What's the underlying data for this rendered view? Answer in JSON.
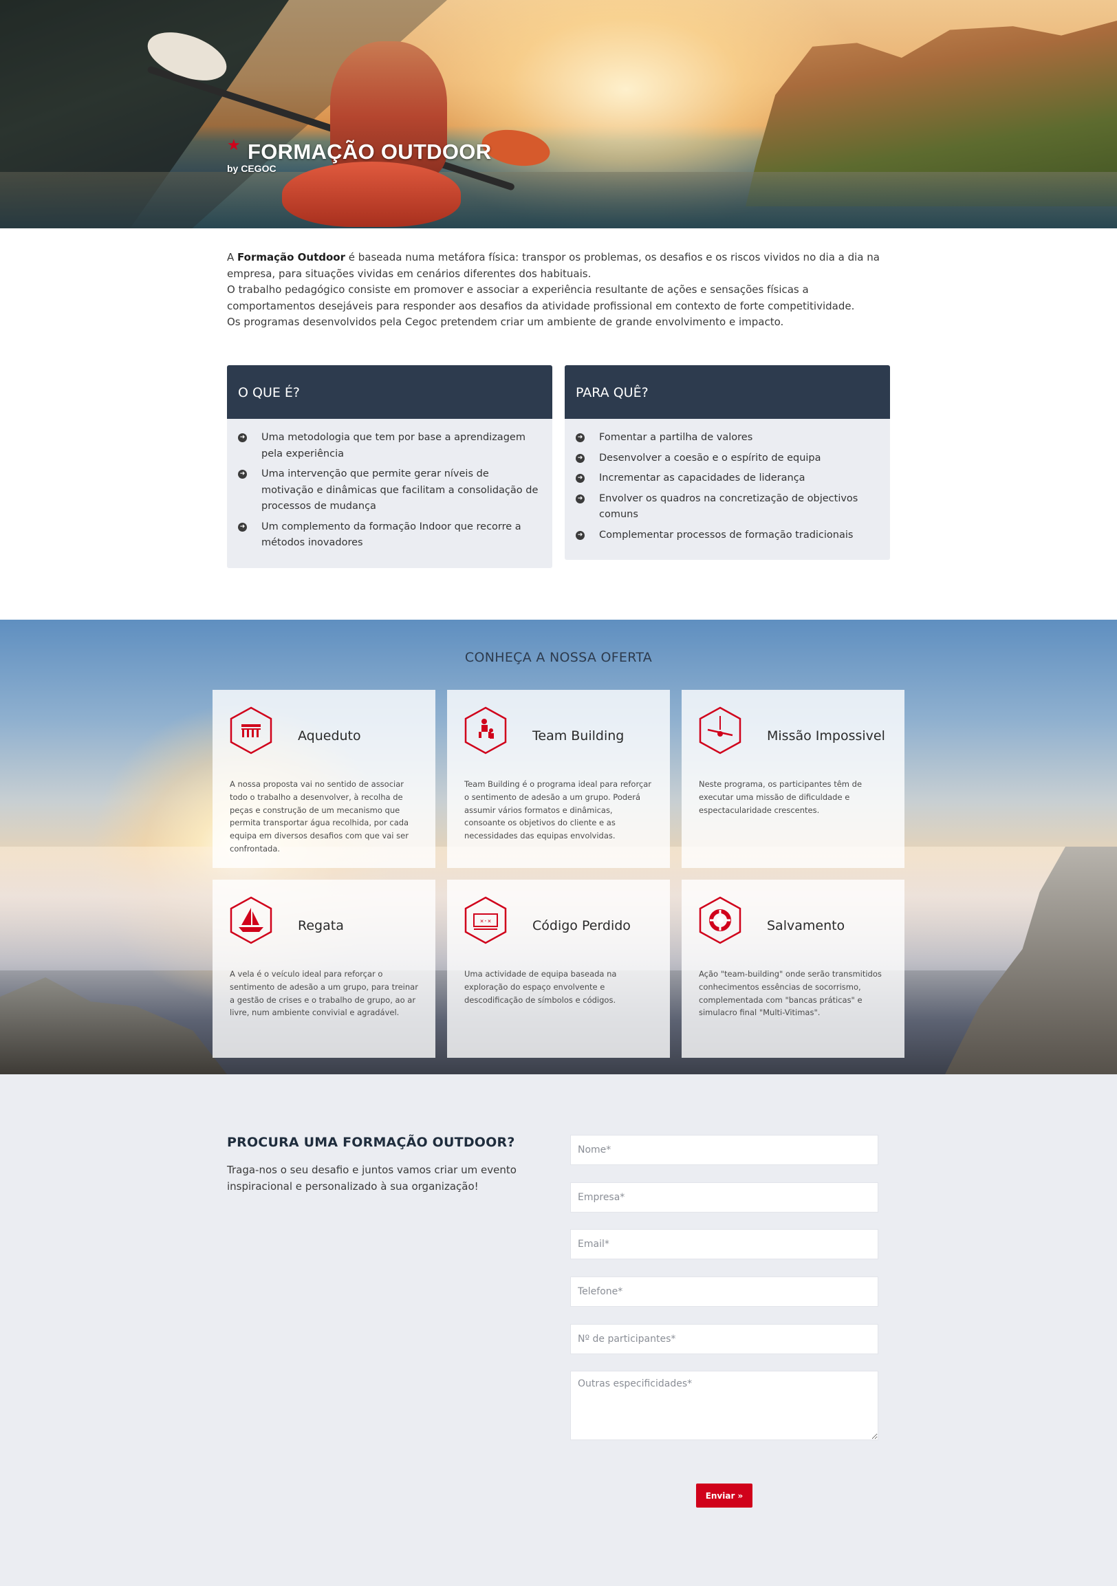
{
  "hero": {
    "title": "FORMAÇÃO OUTDOOR",
    "byline": "by CEGOC"
  },
  "intro": {
    "p1_prefix": "A ",
    "p1_bold": "Formação Outdoor",
    "p1_rest": " é baseada numa metáfora física: transpor os problemas, os desafios e os riscos vividos no dia a dia na empresa, para situações vividas em cenários diferentes dos habituais.",
    "p2": "O trabalho pedagógico consiste em promover e associar a experiência resultante de ações e sensações físicas a comportamentos desejáveis para responder aos desafios da atividade profissional em contexto de forte competitividade.",
    "p3": "Os programas desenvolvidos pela Cegoc pretendem criar um ambiente de grande envolvimento e impacto."
  },
  "what": {
    "title": "O QUE É?",
    "items": [
      "Uma metodologia que tem por base a aprendizagem pela experiência",
      "Uma intervenção que permite gerar níveis de motivação e dinâmicas que facilitam a consolidação de processos de mudança",
      "Um complemento da formação Indoor que recorre a métodos inovadores"
    ]
  },
  "why": {
    "title": "PARA QUÊ?",
    "items": [
      "Fomentar a partilha de valores",
      "Desenvolver a coesão e o espírito de equipa",
      "Incrementar as capacidades de liderança",
      "Envolver os quadros na concretização de objectivos comuns",
      "Complementar processos de formação tradicionais"
    ]
  },
  "offer": {
    "heading": "CONHEÇA A NOSSA OFERTA",
    "cards": [
      {
        "name": "Aqueduto",
        "icon": "aqueduct-icon",
        "desc": "A nossa proposta vai no sentido de associar todo o trabalho a desenvolver, à recolha de peças e construção de um mecanismo que permita transportar água recolhida, por cada equipa em diversos desafios com que vai ser confrontada."
      },
      {
        "name": "Team Building",
        "icon": "team-building-icon",
        "desc": "Team Building é o programa ideal para reforçar o sentimento de adesão a um grupo. Poderá assumir vários formatos e dinâmicas, consoante os objetivos do cliente e as necessidades das equipas envolvidas."
      },
      {
        "name": "Missão Impossivel",
        "icon": "zipline-icon",
        "desc": "Neste programa, os participantes têm de executar uma missão de dificuldade e espectacularidade crescentes."
      },
      {
        "name": "Regata",
        "icon": "sailboat-icon",
        "desc": "A vela é o veículo ideal para reforçar o sentimento de adesão a um grupo, para treinar a gestão de crises e o trabalho de grupo, ao ar livre, num ambiente convivial e agradável."
      },
      {
        "name": "Código Perdido",
        "icon": "code-card-icon",
        "desc": "Uma actividade de equipa baseada na exploração do espaço envolvente e descodificação de símbolos e códigos."
      },
      {
        "name": "Salvamento",
        "icon": "lifebuoy-icon",
        "desc": "Ação \"team-building\" onde serão transmitidos conhecimentos essências de socorrismo, complementada com \"bancas práticas\" e simulacro final \"Multi-Vitimas\"."
      }
    ]
  },
  "contact": {
    "title": "PROCURA UMA FORMAÇÃO OUTDOOR?",
    "subtitle": "Traga-nos o seu desafio e juntos vamos criar um evento inspiracional e personalizado à sua organização!",
    "fields": {
      "name": "Nome*",
      "company": "Empresa*",
      "email": "Email*",
      "phone": "Telefone*",
      "participants": "Nº de participantes*",
      "other": "Outras especificidades*"
    },
    "submit": "Enviar »"
  },
  "colors": {
    "accent": "#d0021b",
    "navy": "#2d3b4e",
    "panel": "#ebedf2"
  }
}
